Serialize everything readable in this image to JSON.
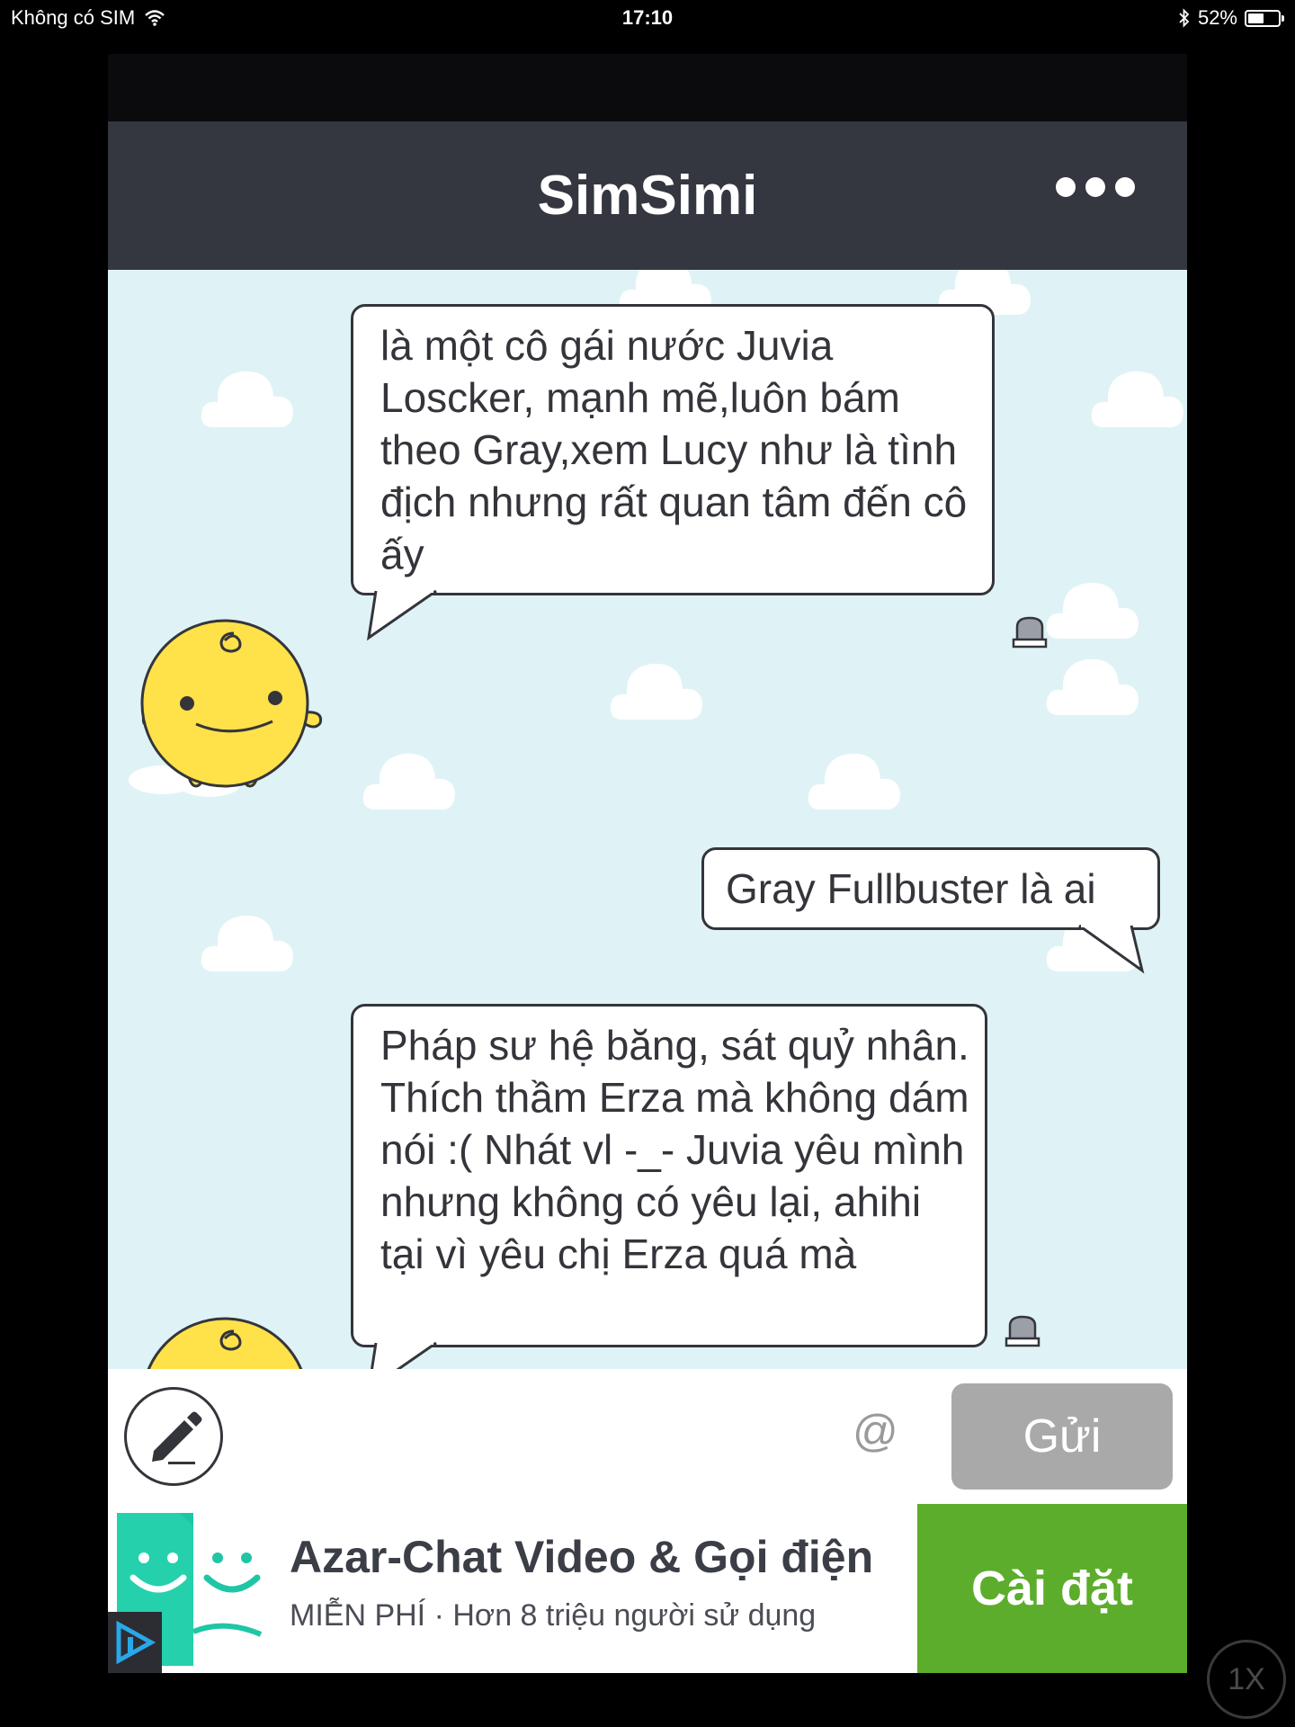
{
  "status_bar": {
    "carrier": "Không có SIM",
    "time": "17:10",
    "battery_percent": "52%",
    "battery_level": 0.52,
    "icons": [
      "wifi-icon",
      "bluetooth-icon",
      "battery-icon"
    ]
  },
  "app": {
    "title": "SimSimi",
    "more_icon": "more-dots-icon"
  },
  "messages": [
    {
      "sender": "simsimi",
      "text": "là một cô gái nước Juvia Loscker, mạnh mẽ,luôn bám theo Gray,xem Lucy như là tình địch nhưng rất quan tâm đến cô ấy"
    },
    {
      "sender": "user",
      "text": "Gray Fullbuster là ai"
    },
    {
      "sender": "simsimi",
      "text": "Pháp sư hệ băng, sát quỷ nhân. Thích thầm Erza mà không dám nói :( Nhát vl -_- Juvia yêu mình nhưng không có yêu lại, ahihi tại vì yêu chị Erza quá mà"
    }
  ],
  "input_bar": {
    "placeholder": "",
    "value": "",
    "at_label": "@",
    "send_label": "Gửi"
  },
  "ad": {
    "title": "Azar-Chat Video & Gọi điện",
    "subtitle": "MIỄN PHÍ · Hơn 8 triệu người sử dụng",
    "install_label": "Cài đặt"
  },
  "zoom_label": "1X",
  "colors": {
    "header": "#343640",
    "chat_bg": "#dff3f6",
    "install_green": "#5cad2b",
    "send_gray": "#a9a9a9",
    "mascot_yellow": "#ffe14a"
  }
}
